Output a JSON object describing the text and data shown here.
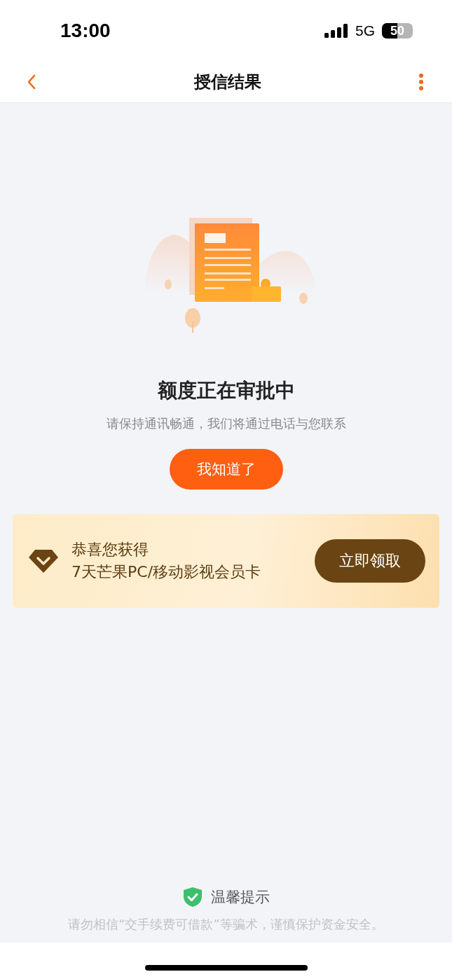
{
  "status_bar": {
    "time": "13:00",
    "network": "5G",
    "battery": "50"
  },
  "nav": {
    "title": "授信结果"
  },
  "result": {
    "title": "额度正在审批中",
    "message": "请保持通讯畅通，我们将通过电话与您联系",
    "button": "我知道了"
  },
  "promo": {
    "line1": "恭喜您获得",
    "line2": "7天芒果PC/移动影视会员卡",
    "button": "立即领取"
  },
  "tip": {
    "title": "温馨提示",
    "message": "请勿相信“交手续费可借款”等骗术，谨慎保护资金安全。"
  }
}
